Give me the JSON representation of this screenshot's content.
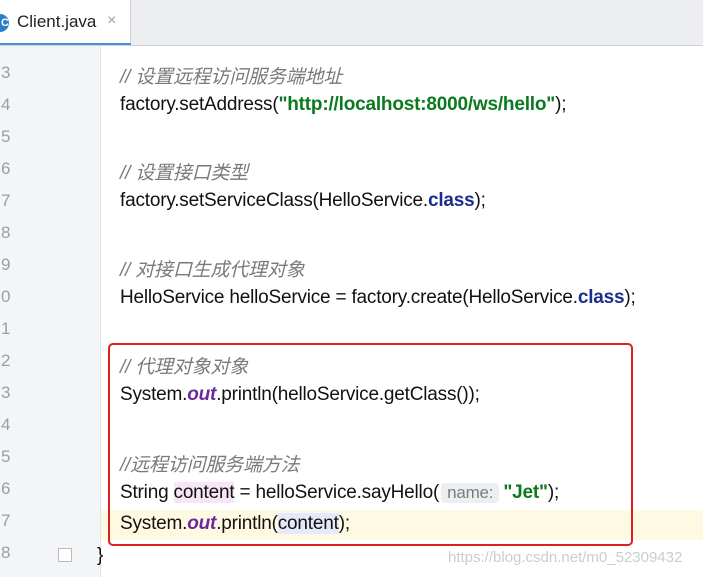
{
  "tab": {
    "title": "Client.java",
    "icon_letter": "C",
    "close": "×"
  },
  "line_numbers": [
    "3",
    "4",
    "5",
    "6",
    "7",
    "8",
    "9",
    "0",
    "1",
    "2",
    "3",
    "4",
    "5",
    "6",
    "7",
    "8"
  ],
  "code": {
    "l3_comment": "// 设置远程访问服务端地址",
    "l4_pre": "factory.setAddress(",
    "l4_str": "\"http://localhost:8000/ws/hello\"",
    "l4_post": ");",
    "l6_comment": "// 设置接口类型",
    "l7_pre": "factory.setServiceClass(HelloService.",
    "l7_kw": "class",
    "l7_post": ");",
    "l9_comment": "// 对接口生成代理对象",
    "l10_pre": "HelloService helloService = factory.create(HelloService.",
    "l10_kw": "class",
    "l10_post": ");",
    "l12_comment": "// 代理对象对象",
    "l13_pre": "System.",
    "l13_field": "out",
    "l13_post": ".println(helloService.getClass());",
    "l15_comment": "//远程访问服务端方法",
    "l16_pre": "String ",
    "l16_var": "content",
    "l16_mid": " = helloService.sayHello(",
    "l16_hint": "name:",
    "l16_str": "\"Jet\"",
    "l16_post": ");",
    "l17_pre": "System.",
    "l17_field": "out",
    "l17_mid": ".println(",
    "l17_var": "content",
    "l17_post": ");",
    "l18_brace": "}"
  },
  "watermark": "https://blog.csdn.net/m0_52309432",
  "colors": {
    "comment": "#7a7a7a",
    "string": "#0b7a1e",
    "keyword": "#1c2d8c",
    "static_field": "#6a2a9a",
    "annotation_box": "#e02020"
  }
}
